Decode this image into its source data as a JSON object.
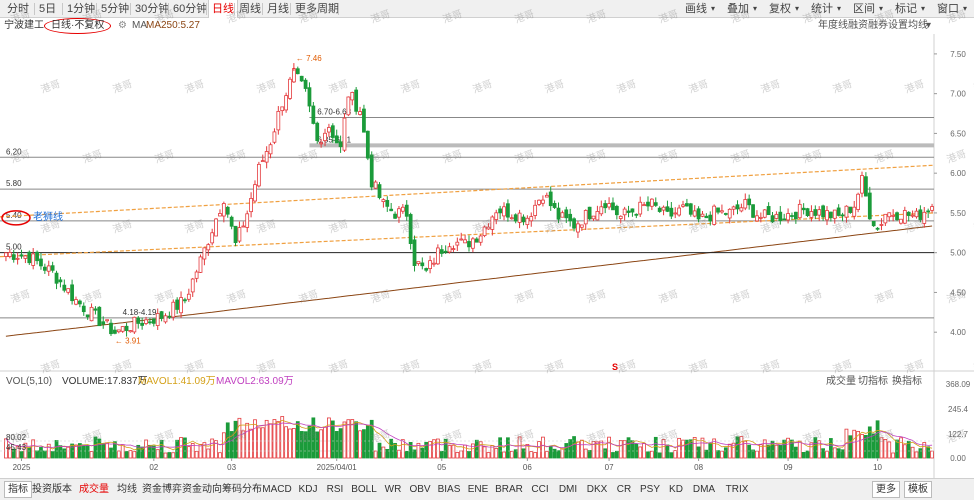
{
  "toolbar": {
    "left_items": [
      "分时",
      "5日",
      "1分钟",
      "5分钟",
      "30分钟",
      "60分钟",
      "日线",
      "周线",
      "月线",
      "更多周期"
    ],
    "active_index": 6,
    "right_items": [
      "画线",
      "叠加",
      "复权",
      "统计",
      "区间",
      "标记",
      "窗口"
    ],
    "expand_glyph": "▾"
  },
  "info": {
    "stock_name": "宁波建工",
    "period_label": "日线·不复权",
    "ma_label": "MA",
    "ma_value": "MA250:5.27",
    "right_links": [
      "年度线",
      "融资融券",
      "设置均线"
    ]
  },
  "chart_data": {
    "type": "candlestick",
    "price_axis": {
      "min": 3.6,
      "max": 7.7,
      "ticks": [
        4.0,
        4.5,
        5.0,
        5.5,
        6.0,
        6.5,
        7.0,
        7.5
      ]
    },
    "volume_axis": {
      "max": 3960000,
      "tick_labels": [
        "368.09",
        "245.4",
        "122.7",
        "0.00"
      ]
    },
    "month_labels": [
      "2025",
      "02",
      "03",
      "2025/04/01",
      "05",
      "06",
      "07",
      "08",
      "09",
      "10"
    ],
    "horizontal_levels": [
      {
        "price": 5.0,
        "label": "5.00"
      },
      {
        "price": 5.4,
        "label": "5.40"
      },
      {
        "price": 5.8,
        "label": "5.80"
      },
      {
        "price": 6.2,
        "label": "6.20"
      },
      {
        "price": 6.35,
        "label": "6.35-6.31"
      },
      {
        "price": 6.7,
        "label": "6.70-6.68"
      },
      {
        "price": 4.18,
        "label": "4.18-4.19"
      }
    ],
    "annotations": {
      "high_label": "7.46",
      "low_label": "3.91",
      "lion_line_label": "老狮线",
      "marker": "S"
    },
    "anchors": [
      [
        0,
        5.0
      ],
      [
        6,
        4.95
      ],
      [
        12,
        4.75
      ],
      [
        18,
        4.4
      ],
      [
        24,
        4.15
      ],
      [
        28,
        4.0
      ],
      [
        34,
        4.12
      ],
      [
        40,
        4.2
      ],
      [
        46,
        4.4
      ],
      [
        50,
        4.9
      ],
      [
        53,
        5.3
      ],
      [
        56,
        5.7
      ],
      [
        59,
        5.1
      ],
      [
        62,
        5.5
      ],
      [
        65,
        6.05
      ],
      [
        68,
        6.4
      ],
      [
        71,
        6.9
      ],
      [
        74,
        7.25
      ],
      [
        77,
        7.0
      ],
      [
        80,
        6.4
      ],
      [
        83,
        6.6
      ],
      [
        86,
        6.3
      ],
      [
        88,
        7.0
      ],
      [
        91,
        6.8
      ],
      [
        94,
        5.9
      ],
      [
        97,
        5.6
      ],
      [
        100,
        5.5
      ],
      [
        103,
        5.5
      ],
      [
        105,
        4.9
      ],
      [
        108,
        4.75
      ],
      [
        111,
        5.0
      ],
      [
        114,
        5.15
      ],
      [
        118,
        5.1
      ],
      [
        122,
        5.25
      ],
      [
        126,
        5.55
      ],
      [
        130,
        5.5
      ],
      [
        134,
        5.45
      ],
      [
        138,
        5.75
      ],
      [
        142,
        5.45
      ],
      [
        146,
        5.35
      ],
      [
        150,
        5.5
      ],
      [
        154,
        5.65
      ],
      [
        158,
        5.45
      ],
      [
        162,
        5.55
      ],
      [
        166,
        5.6
      ],
      [
        170,
        5.45
      ],
      [
        174,
        5.55
      ],
      [
        178,
        5.4
      ],
      [
        182,
        5.5
      ],
      [
        186,
        5.5
      ],
      [
        190,
        5.6
      ],
      [
        194,
        5.45
      ],
      [
        198,
        5.45
      ],
      [
        202,
        5.5
      ],
      [
        206,
        5.55
      ],
      [
        210,
        5.5
      ],
      [
        214,
        5.45
      ],
      [
        218,
        5.6
      ],
      [
        220,
        5.9
      ],
      [
        222,
        5.5
      ],
      [
        224,
        5.3
      ],
      [
        226,
        5.5
      ],
      [
        230,
        5.5
      ],
      [
        234,
        5.45
      ],
      [
        238,
        5.6
      ]
    ],
    "candle_count": 239
  },
  "sub_indicator": {
    "name": "VOL(5,10)",
    "volume": "VOLUME:17.837万",
    "ma5": "MAVOL1:41.09万",
    "ma10": "MAVOL2:63.09万",
    "right": [
      "成交量",
      "切指标",
      "换指标"
    ],
    "level_labels": [
      "80.02",
      "45.43"
    ]
  },
  "bottom_tabs": {
    "items": [
      "指标",
      "投资版本",
      "成交量",
      "均线",
      "资金博弈",
      "资金动向",
      "筹码分布",
      "MACD",
      "KDJ",
      "RSI",
      "BOLL",
      "WR",
      "OBV",
      "BIAS",
      "ENE",
      "BRAR",
      "CCI",
      "DMI",
      "DKX",
      "CR",
      "PSY",
      "KD",
      "DMA",
      "TRIX",
      "更多",
      "模板"
    ],
    "active_index": 2
  },
  "watermark_text": "港哥",
  "colors": {
    "up": "#e4393c",
    "down": "#1b9b3a",
    "accent_red": "#e60000",
    "orange_trend": "#f0a040",
    "ma250": "#8b4513",
    "level_line": "#888888",
    "active_blue": "#1e6fd9"
  }
}
